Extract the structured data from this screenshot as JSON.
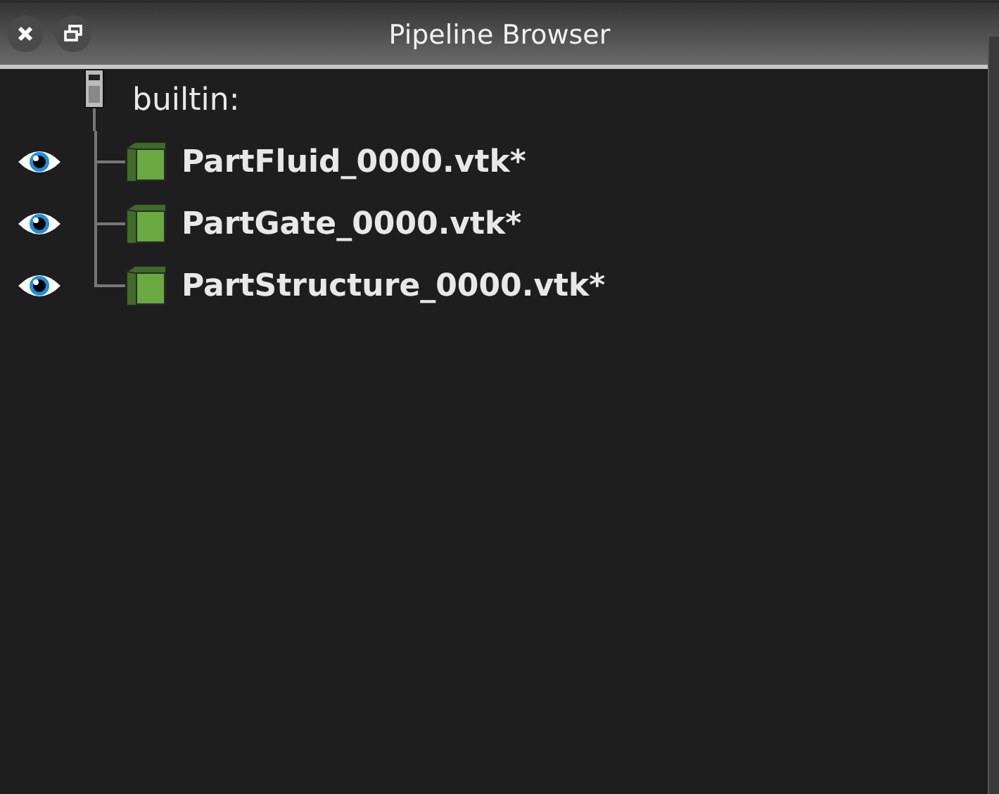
{
  "panel": {
    "title": "Pipeline Browser"
  },
  "tree": [
    {
      "label": "builtin:",
      "kind": "server",
      "children": [
        {
          "label": "PartFluid_0000.vtk*",
          "kind": "source",
          "visible": true
        },
        {
          "label": "PartGate_0000.vtk*",
          "kind": "source",
          "visible": true
        },
        {
          "label": "PartStructure_0000.vtk*",
          "kind": "source",
          "visible": true
        }
      ]
    }
  ]
}
